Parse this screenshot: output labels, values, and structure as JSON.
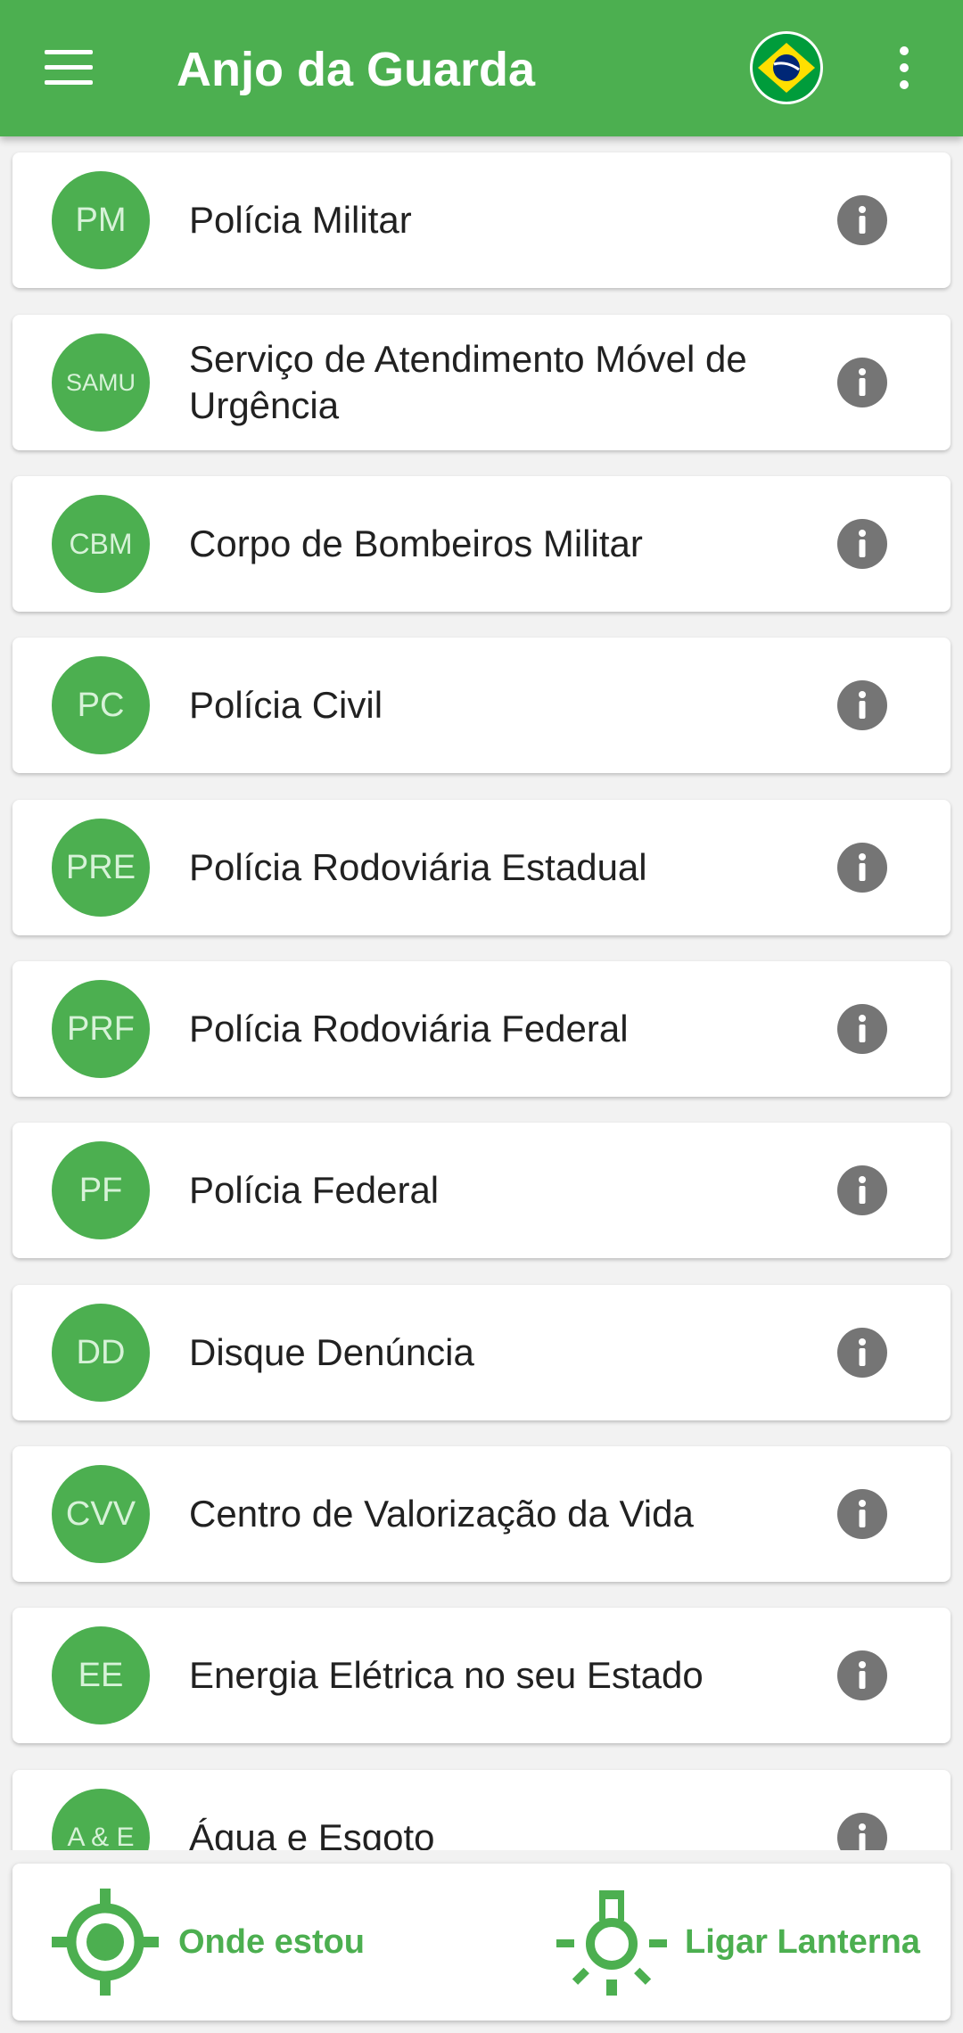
{
  "appbar": {
    "title": "Anjo da Guarda",
    "menu_icon": "hamburger-menu-icon",
    "flag_icon": "brazil-flag-icon",
    "more_icon": "more-vertical-icon"
  },
  "colors": {
    "primary": "#4caf50",
    "avatar_text": "#d7f2d8",
    "info_icon": "#757575",
    "text": "#212121",
    "background": "#f2f2f2"
  },
  "services": [
    {
      "abbr": "PM",
      "name": "Polícia Militar"
    },
    {
      "abbr": "SAMU",
      "name": "Serviço de Atendimento Móvel de Urgência"
    },
    {
      "abbr": "CBM",
      "name": "Corpo de Bombeiros Militar"
    },
    {
      "abbr": "PC",
      "name": "Polícia Civil"
    },
    {
      "abbr": "PRE",
      "name": "Polícia Rodoviária Estadual"
    },
    {
      "abbr": "PRF",
      "name": "Polícia Rodoviária Federal"
    },
    {
      "abbr": "PF",
      "name": "Polícia Federal"
    },
    {
      "abbr": "DD",
      "name": "Disque Denúncia"
    },
    {
      "abbr": "CVV",
      "name": "Centro de Valorização da Vida"
    },
    {
      "abbr": "EE",
      "name": "Energia Elétrica no seu Estado"
    },
    {
      "abbr": "A & E",
      "name": "Água e Esgoto"
    }
  ],
  "bottom": {
    "location_label": "Onde estou",
    "location_icon": "gps-location-icon",
    "torch_label": "Ligar Lanterna",
    "torch_icon": "flashlight-icon"
  }
}
